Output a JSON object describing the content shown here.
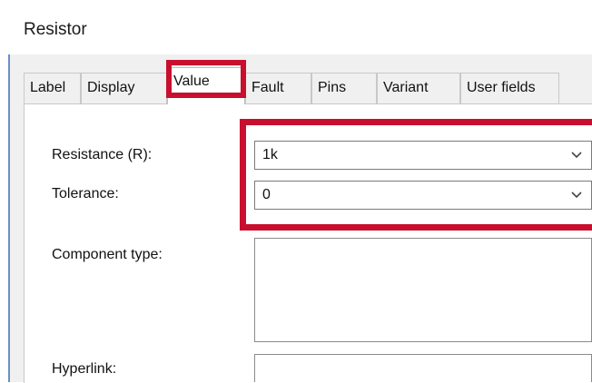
{
  "window": {
    "title": "Resistor"
  },
  "tabs": [
    {
      "label": "Label"
    },
    {
      "label": "Display"
    },
    {
      "label": "Value"
    },
    {
      "label": "Fault"
    },
    {
      "label": "Pins"
    },
    {
      "label": "Variant"
    },
    {
      "label": "User fields"
    }
  ],
  "active_tab": "Value",
  "form": {
    "resistance": {
      "label": "Resistance (R):",
      "value": "1k",
      "icon": "chevron-down-icon"
    },
    "tolerance": {
      "label": "Tolerance:",
      "value": "0",
      "icon": "chevron-down-icon"
    },
    "component_type": {
      "label": "Component type:",
      "value": ""
    },
    "hyperlink": {
      "label": "Hyperlink:",
      "value": ""
    }
  },
  "colors": {
    "highlight": "#c8102e",
    "window_border": "#6a8fc8",
    "dialog_bg": "#f0f0f0"
  }
}
